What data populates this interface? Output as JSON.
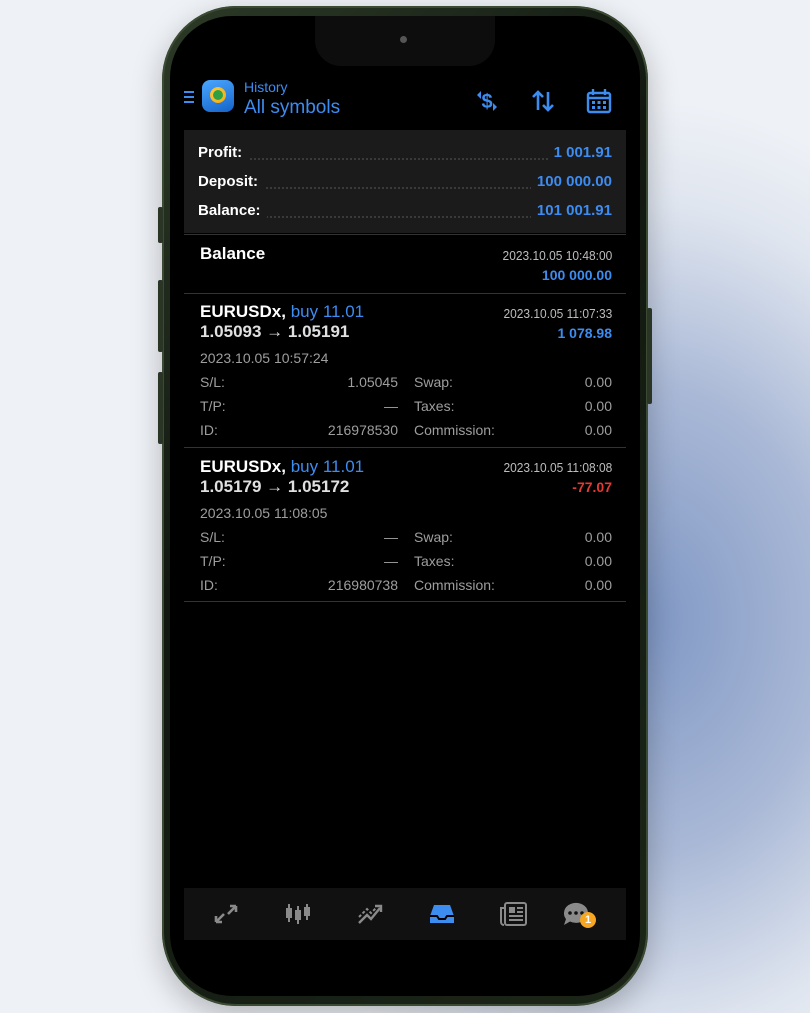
{
  "header": {
    "subtitle": "History",
    "title": "All symbols",
    "icons": [
      "dollar-swap-icon",
      "sort-icon",
      "calendar-icon"
    ]
  },
  "summary": {
    "profit_label": "Profit:",
    "profit_value": "1 001.91",
    "deposit_label": "Deposit:",
    "deposit_value": "100 000.00",
    "balance_label": "Balance:",
    "balance_value": "101 001.91"
  },
  "balance_entry": {
    "title": "Balance",
    "datetime": "2023.10.05 10:48:00",
    "amount": "100 000.00"
  },
  "trades": [
    {
      "symbol": "EURUSDx,",
      "side": "buy 11.01",
      "prices": "1.05093 → 1.05191",
      "close_time": "2023.10.05 11:07:33",
      "profit": "1 078.98",
      "open_time": "2023.10.05 10:57:24",
      "sl_label": "S/L:",
      "sl_value": "1.05045",
      "swap_label": "Swap:",
      "swap_value": "0.00",
      "tp_label": "T/P:",
      "tp_value": "—",
      "taxes_label": "Taxes:",
      "taxes_value": "0.00",
      "id_label": "ID:",
      "id_value": "216978530",
      "commission_label": "Commission:",
      "commission_value": "0.00"
    },
    {
      "symbol": "EURUSDx,",
      "side": "buy 11.01",
      "prices": "1.05179 → 1.05172",
      "close_time": "2023.10.05 11:08:08",
      "profit": "-77.07",
      "open_time": "2023.10.05 11:08:05",
      "sl_label": "S/L:",
      "sl_value": "—",
      "swap_label": "Swap:",
      "swap_value": "0.00",
      "tp_label": "T/P:",
      "tp_value": "—",
      "taxes_label": "Taxes:",
      "taxes_value": "0.00",
      "id_label": "ID:",
      "id_value": "216980738",
      "commission_label": "Commission:",
      "commission_value": "0.00"
    }
  ],
  "tabbar": {
    "tabs": [
      "quotes-icon",
      "chart-icon",
      "trade-icon",
      "history-icon",
      "news-icon",
      "chat-icon"
    ],
    "active": "history-icon",
    "chat_badge": "1"
  },
  "colors": {
    "accent": "#3d8cf0",
    "negative": "#e53935",
    "badge": "#f5a623"
  }
}
